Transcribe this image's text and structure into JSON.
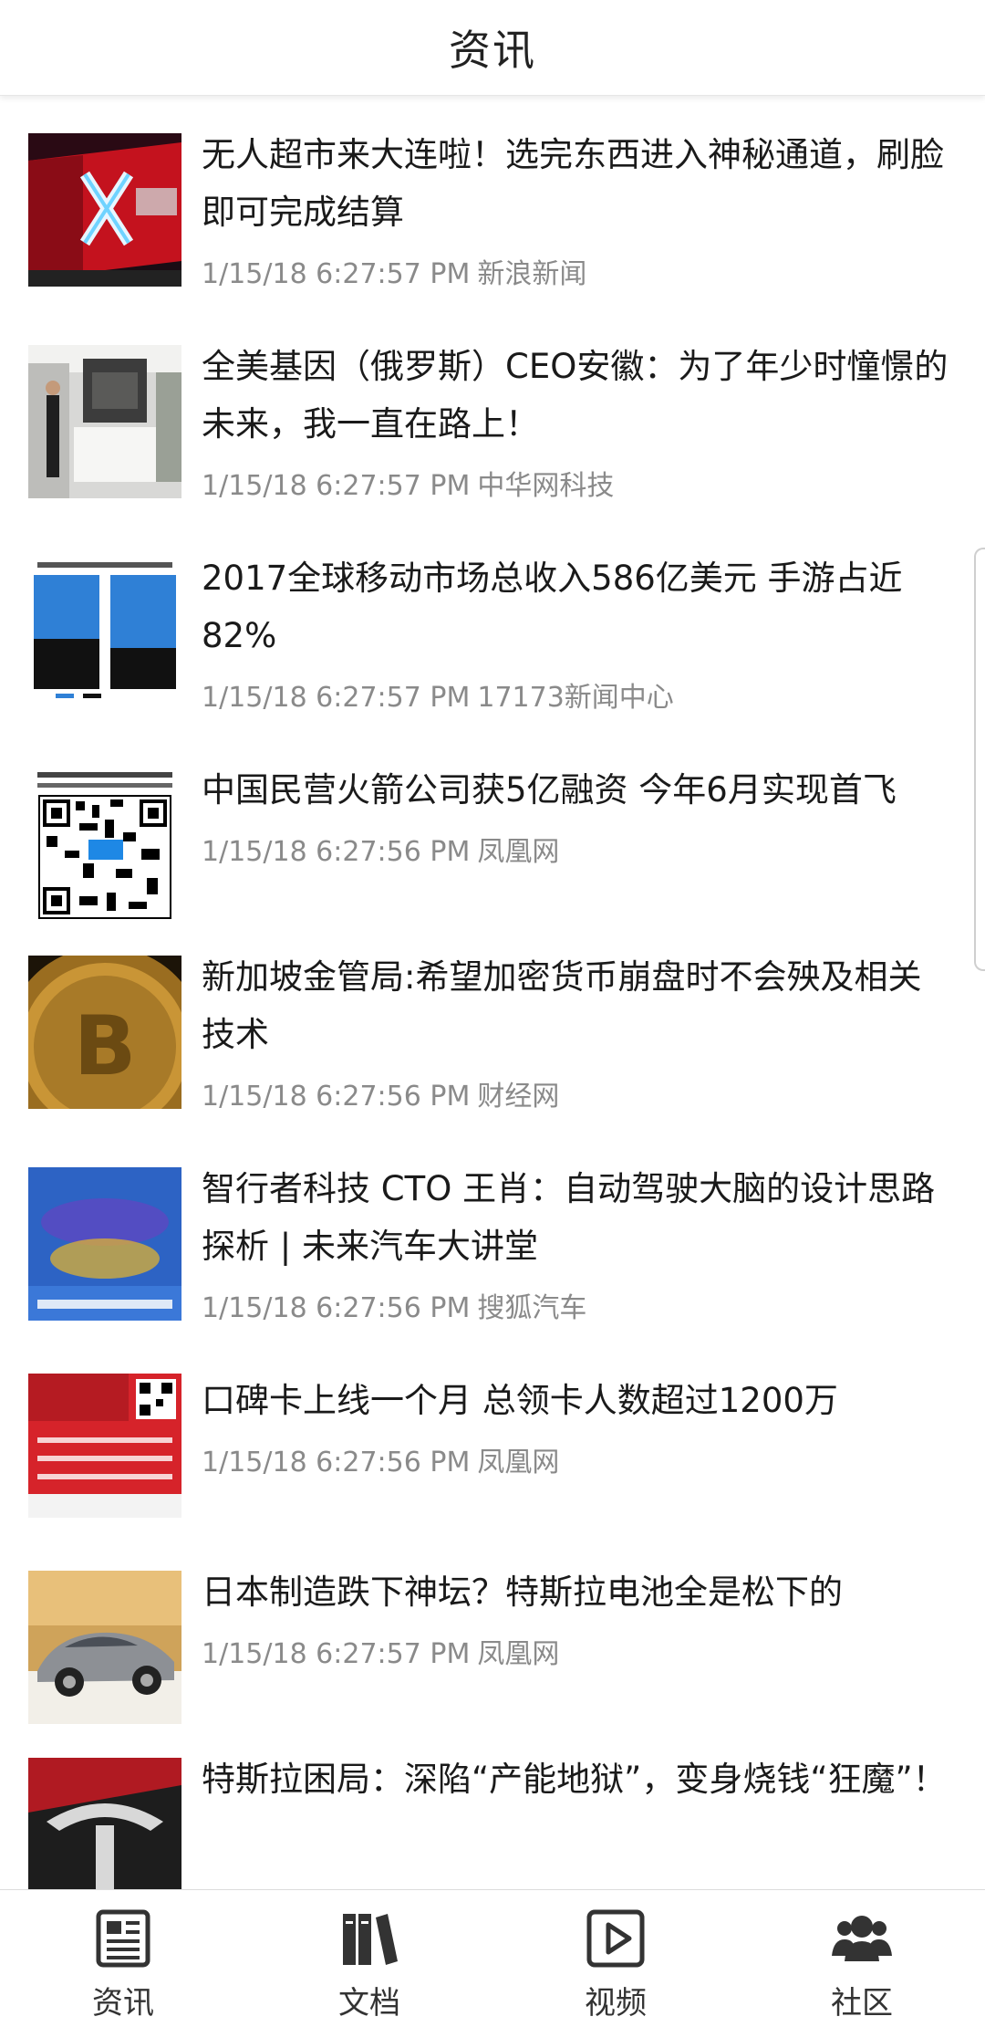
{
  "header": {
    "title": "资讯"
  },
  "news": [
    {
      "title": "无人超市来大连啦！选完东西进入神秘通道，刷脸即可完成结算",
      "time": "1/15/18 6:27:57 PM",
      "source": "新浪新闻",
      "thumb": "store-neon-x"
    },
    {
      "title": "全美基因（俄罗斯）CEO安徽：为了年少时憧憬的未来，我一直在路上！",
      "time": "1/15/18 6:27:57 PM",
      "source": "中华网科技",
      "thumb": "office-lobby"
    },
    {
      "title": "2017全球移动市场总收入586亿美元 手游占近82%",
      "time": "1/15/18 6:27:57 PM",
      "source": "17173新闻中心",
      "thumb": "bar-chart-image"
    },
    {
      "title": "中国民营火箭公司获5亿融资 今年6月实现首飞",
      "time": "1/15/18 6:27:56 PM",
      "source": "凤凰网",
      "thumb": "qr-code-image"
    },
    {
      "title": "新加坡金管局:希望加密货币崩盘时不会殃及相关技术",
      "time": "1/15/18 6:27:56 PM",
      "source": "财经网",
      "thumb": "bitcoin-coin"
    },
    {
      "title": "智行者科技 CTO 王肖：自动驾驶大脑的设计思路探析 | 未来汽车大讲堂",
      "time": "1/15/18 6:27:56 PM",
      "source": "搜狐汽车",
      "thumb": "autonomous-driving-poster"
    },
    {
      "title": "口碑卡上线一个月 总领卡人数超过1200万",
      "time": "1/15/18 6:27:56 PM",
      "source": "凤凰网",
      "thumb": "finance-banner"
    },
    {
      "title": "日本制造跌下神坛？特斯拉电池全是松下的",
      "time": "1/15/18 6:27:57 PM",
      "source": "凤凰网",
      "thumb": "silver-car"
    },
    {
      "title": "特斯拉困局：深陷“产能地狱”，变身烧钱“狂魔”！",
      "time": "",
      "source": "",
      "thumb": "tesla-logo"
    }
  ],
  "tabs": [
    {
      "label": "资讯",
      "icon": "newspaper-icon"
    },
    {
      "label": "文档",
      "icon": "books-icon"
    },
    {
      "label": "视频",
      "icon": "play-video-icon"
    },
    {
      "label": "社区",
      "icon": "community-users-icon"
    }
  ]
}
